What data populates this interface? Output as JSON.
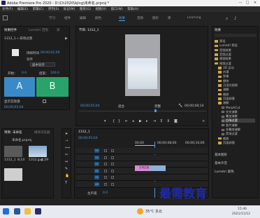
{
  "window": {
    "title": "Adobe Premiere Pro 2020 - D:\\Ch2020\\bjing\\未命名.prproj *",
    "controls": [
      "—",
      "□",
      "✕"
    ]
  },
  "menu": [
    "文件(F)",
    "编辑(E)",
    "剪辑(C)",
    "序列(S)",
    "标记(M)",
    "图形(G)",
    "视图(V)",
    "窗口(W)",
    "帮助(H)"
  ],
  "workspaces": [
    "学习",
    "组件",
    "编辑",
    "颜色",
    "效果",
    "音频",
    "图形",
    "库",
    "Learning"
  ],
  "active_workspace": "效果",
  "effect_controls": {
    "tabs": [
      "效果控件",
      "Lumetri 范围",
      "源"
    ],
    "clip": "1312_1 » 白场过渡",
    "duration_label": "持续时间",
    "duration_value": "00;00;01;00",
    "align_label": "对齐",
    "align_value": "居中对齐",
    "start_label": "开始：",
    "start_value": "0.0",
    "end_label": "结束：",
    "end_value": "100.0",
    "box_a": "A",
    "box_b": "B",
    "show_actual": "显示实际源",
    "timecode": "00;00;05;04"
  },
  "program_monitor": {
    "title": "节目: 1312_1",
    "timecode_left": "00;00;05;04",
    "fit": "适合",
    "quality": "完整",
    "timecode_right": "00;00;08;14"
  },
  "effects_panel": {
    "title": "效果",
    "items": [
      {
        "label": "预设",
        "kind": "folder",
        "indent": 0
      },
      {
        "label": "Lumetri 预设",
        "kind": "folder",
        "indent": 0
      },
      {
        "label": "音频效果",
        "kind": "folder",
        "indent": 0
      },
      {
        "label": "音频过渡",
        "kind": "folder",
        "indent": 0
      },
      {
        "label": "视频效果",
        "kind": "folder",
        "indent": 0
      },
      {
        "label": "视频过渡",
        "kind": "folder",
        "indent": 0
      },
      {
        "label": "3D 运动",
        "kind": "folder",
        "indent": 1
      },
      {
        "label": "内滑",
        "kind": "folder",
        "indent": 1
      },
      {
        "label": "划像",
        "kind": "folder",
        "indent": 1
      },
      {
        "label": "擦除",
        "kind": "folder",
        "indent": 1
      },
      {
        "label": "沉浸式视频",
        "kind": "folder",
        "indent": 1
      },
      {
        "label": "溶解",
        "kind": "folder",
        "indent": 1
      },
      {
        "label": "缩放",
        "kind": "folder",
        "indent": 1
      },
      {
        "label": "页面剥落",
        "kind": "folder",
        "indent": 1
      },
      {
        "label": "溶解",
        "kind": "folder",
        "indent": 1
      },
      {
        "label": "MorphCut",
        "kind": "item",
        "indent": 2
      },
      {
        "label": "交叉溶解",
        "kind": "item",
        "indent": 2
      },
      {
        "label": "叠加溶解",
        "kind": "item",
        "indent": 2
      },
      {
        "label": "白场过渡",
        "kind": "item",
        "indent": 2,
        "selected": true
      },
      {
        "label": "胶片溶解",
        "kind": "item",
        "indent": 2
      },
      {
        "label": "非叠加溶解",
        "kind": "item",
        "indent": 2
      },
      {
        "label": "黑场过渡",
        "kind": "item",
        "indent": 2
      },
      {
        "label": "缩放",
        "kind": "folder",
        "indent": 1
      },
      {
        "label": "页面剥落",
        "kind": "folder",
        "indent": 1
      }
    ],
    "sections": [
      "基本图形",
      "基本声音",
      "Lumetri 颜色"
    ]
  },
  "project_panel": {
    "tabs": [
      "项目: 未命名",
      "媒体浏览器"
    ],
    "search_placeholder": "未命名.prproj",
    "items": [
      {
        "name": "1312_1",
        "duration": "8;14"
      },
      {
        "name": "1312.jpg",
        "duration": "4;29"
      }
    ]
  },
  "timeline": {
    "sequence": "1312_1",
    "timecode": "00;00;05;04",
    "ruler": [
      "00;00",
      "00;00;08;00",
      "00;00;16;00"
    ],
    "tracks": [
      "V3",
      "V2",
      "V1",
      "A1",
      "A2",
      "A3"
    ],
    "master": "主声道",
    "master_value": "0.0",
    "clip_label": "白场过渡"
  },
  "watermark": "最需教育",
  "taskbar": {
    "weather": "35°C 多云",
    "time": "15:46",
    "date": "2021/11/12"
  }
}
